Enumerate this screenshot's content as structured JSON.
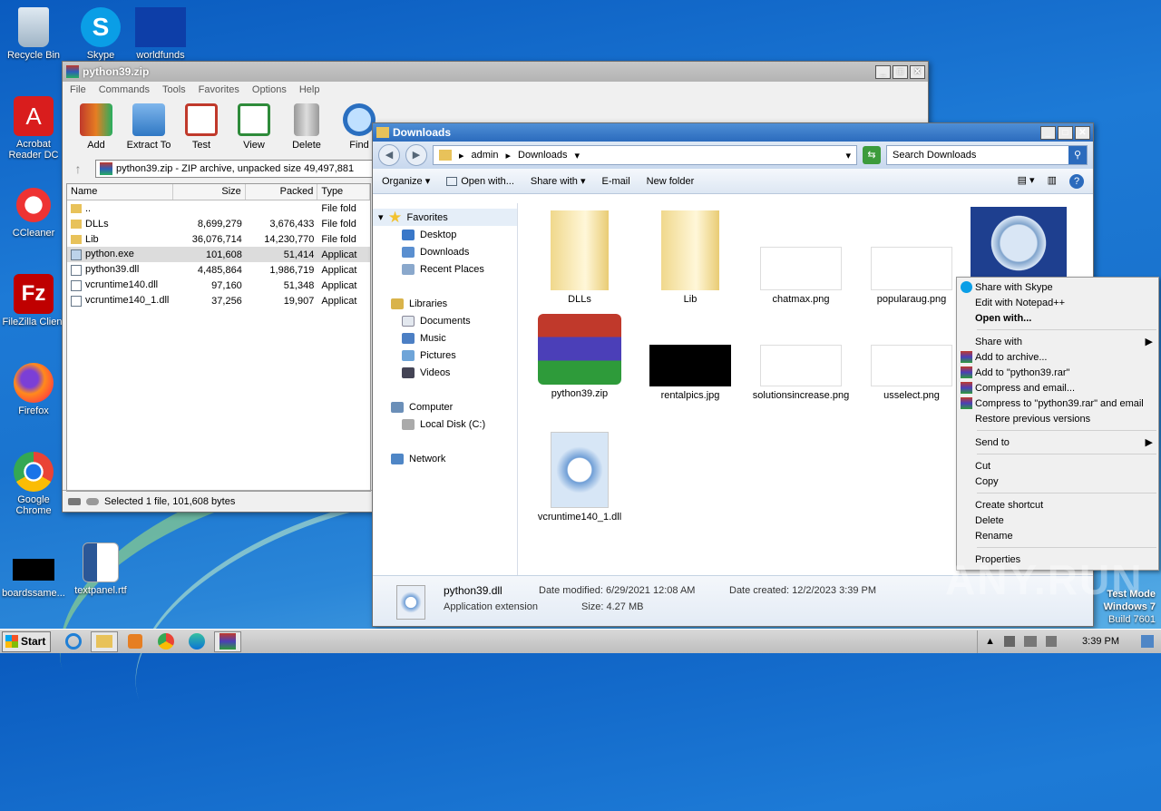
{
  "desktop": {
    "icons": [
      {
        "label": "Recycle Bin"
      },
      {
        "label": "Skype"
      },
      {
        "label": "worldfunds"
      },
      {
        "label": "Acrobat Reader DC"
      },
      {
        "label": "CCleaner"
      },
      {
        "label": "FileZilla Client"
      },
      {
        "label": "Firefox"
      },
      {
        "label": "Google Chrome"
      },
      {
        "label": "boardssame..."
      },
      {
        "label": "textpanel.rtf"
      }
    ],
    "watermark": "ANY.RUN",
    "test_mode": {
      "line1": "Test Mode",
      "line2": "Windows 7",
      "line3": "Build 7601"
    }
  },
  "winrar": {
    "title": "python39.zip",
    "menu": [
      "File",
      "Commands",
      "Tools",
      "Favorites",
      "Options",
      "Help"
    ],
    "tools": [
      "Add",
      "Extract To",
      "Test",
      "View",
      "Delete",
      "Find"
    ],
    "address": "python39.zip - ZIP archive, unpacked size 49,497,881",
    "columns": [
      "Name",
      "Size",
      "Packed",
      "Type"
    ],
    "rows": [
      {
        "name": "..",
        "size": "",
        "packed": "",
        "type": "File fold"
      },
      {
        "name": "DLLs",
        "size": "8,699,279",
        "packed": "3,676,433",
        "type": "File fold"
      },
      {
        "name": "Lib",
        "size": "36,076,714",
        "packed": "14,230,770",
        "type": "File fold"
      },
      {
        "name": "python.exe",
        "size": "101,608",
        "packed": "51,414",
        "type": "Applicat"
      },
      {
        "name": "python39.dll",
        "size": "4,485,864",
        "packed": "1,986,719",
        "type": "Applicat"
      },
      {
        "name": "vcruntime140.dll",
        "size": "97,160",
        "packed": "51,348",
        "type": "Applicat"
      },
      {
        "name": "vcruntime140_1.dll",
        "size": "37,256",
        "packed": "19,907",
        "type": "Applicat"
      }
    ],
    "status": "Selected 1 file, 101,608 bytes"
  },
  "explorer": {
    "title": "Downloads",
    "breadcrumb": [
      "admin",
      "Downloads"
    ],
    "search_placeholder": "Search Downloads",
    "commands": [
      "Organize",
      "Open with...",
      "Share with",
      "E-mail",
      "New folder"
    ],
    "nav": {
      "favorites": "Favorites",
      "desktop": "Desktop",
      "downloads": "Downloads",
      "recent": "Recent Places",
      "libraries": "Libraries",
      "documents": "Documents",
      "music": "Music",
      "pictures": "Pictures",
      "videos": "Videos",
      "computer": "Computer",
      "localdisk": "Local Disk (C:)",
      "network": "Network"
    },
    "files": [
      {
        "name": "DLLs"
      },
      {
        "name": "Lib"
      },
      {
        "name": "chatmax.png"
      },
      {
        "name": "popularaug.png"
      },
      {
        "name": "python39.zip"
      },
      {
        "name": "rentalpics.jpg"
      },
      {
        "name": "solutionsincrease.png"
      },
      {
        "name": "usselect.png"
      },
      {
        "name": "vcruntime140_1.dll"
      }
    ],
    "details": {
      "filename": "python39.dll",
      "type": "Application extension",
      "modified": "Date modified: 6/29/2021 12:08 AM",
      "size": "Size: 4.27 MB",
      "created": "Date created: 12/2/2023 3:39 PM"
    }
  },
  "context_menu": {
    "items": [
      "Share with Skype",
      "Edit with Notepad++",
      "Open with...",
      "Share with",
      "Add to archive...",
      "Add to \"python39.rar\"",
      "Compress and email...",
      "Compress to \"python39.rar\" and email",
      "Restore previous versions",
      "Send to",
      "Cut",
      "Copy",
      "Create shortcut",
      "Delete",
      "Rename",
      "Properties"
    ]
  },
  "taskbar": {
    "start": "Start",
    "time": "3:39 PM"
  }
}
